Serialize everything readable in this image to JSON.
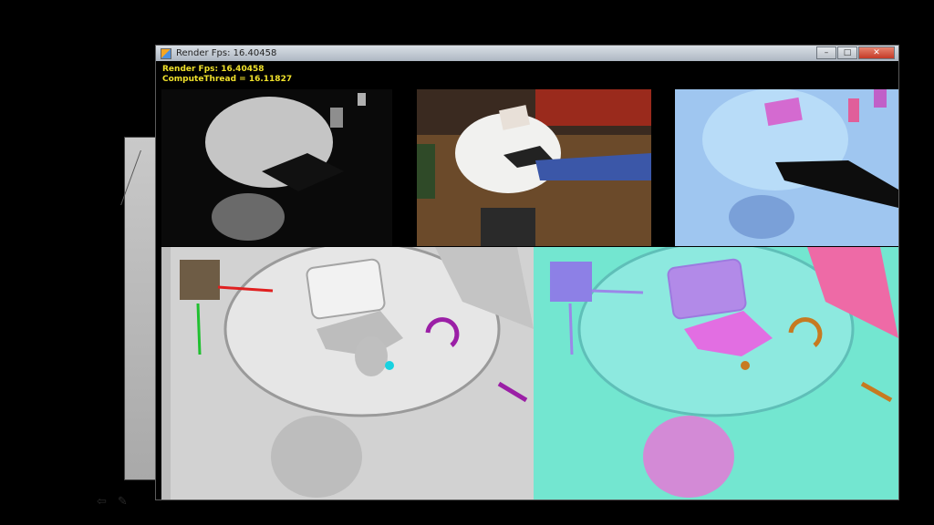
{
  "window": {
    "title": "Render Fps: 16.40458",
    "controls": {
      "minimize": "–",
      "maximize": "□",
      "close": "✕"
    }
  },
  "overlay": {
    "render_fps": "Render Fps: 16.40458",
    "compute_thread": "ComputeThread = 16.11827"
  },
  "panes": {
    "depth": {
      "icon": "depth-camera-view"
    },
    "rgb": {
      "icon": "rgb-camera-view"
    },
    "normals": {
      "icon": "normal-map-view"
    },
    "shaded": {
      "icon": "shaded-reconstruction-view"
    },
    "normal_recon": {
      "icon": "normal-reconstruction-view"
    }
  },
  "taskbar": {
    "icons": [
      "back-arrow-icon",
      "pen-icon"
    ]
  },
  "colors": {
    "title_text": "#f0e12b",
    "axis_red": "#e02020",
    "axis_green": "#20c030",
    "magenta_marker": "#9b1fa6",
    "cyan_marker": "#18d2e0"
  }
}
